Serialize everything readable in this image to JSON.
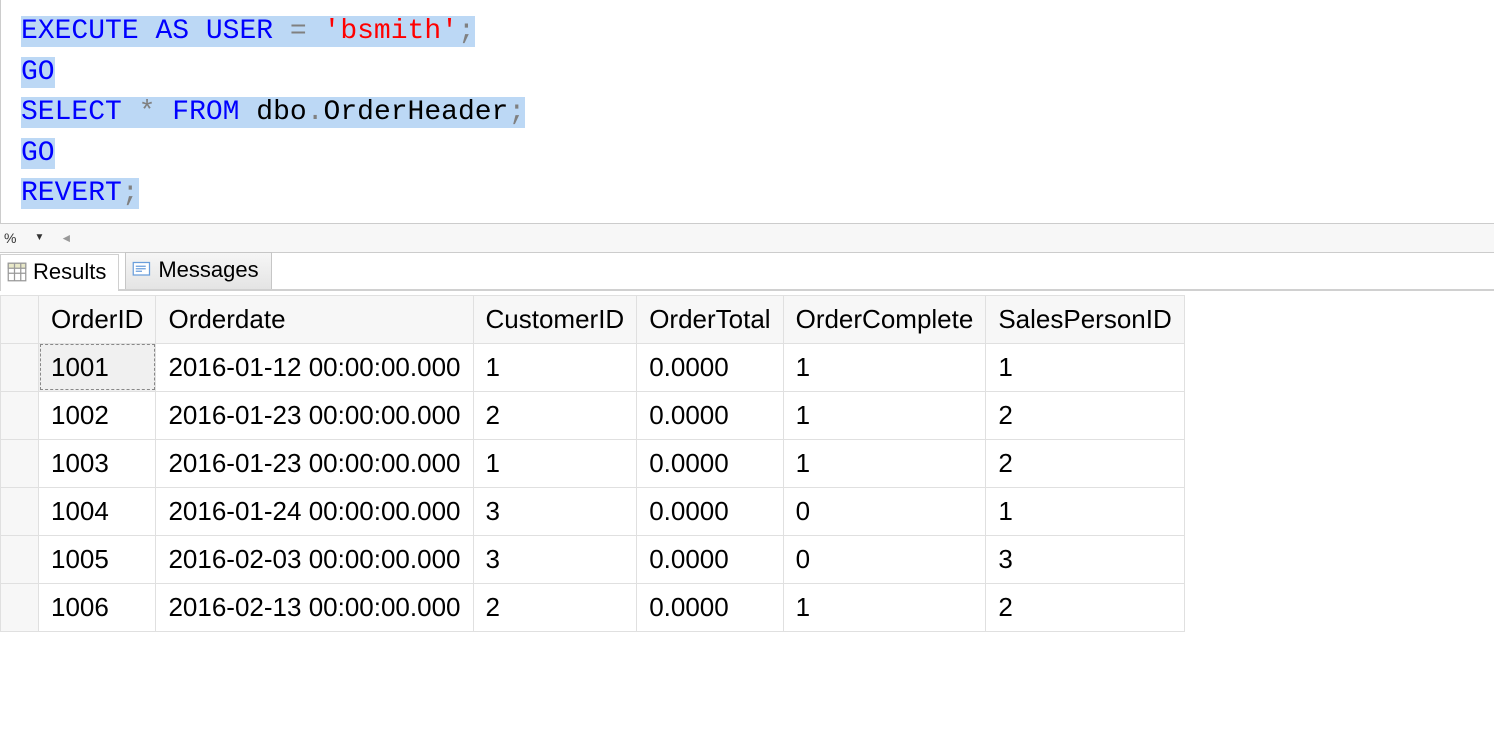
{
  "editor": {
    "lines": [
      [
        {
          "t": "EXECUTE",
          "cls": "kw hl"
        },
        {
          "t": " ",
          "cls": "hl"
        },
        {
          "t": "AS",
          "cls": "kw hl"
        },
        {
          "t": " ",
          "cls": "hl"
        },
        {
          "t": "USER",
          "cls": "kw hl"
        },
        {
          "t": " ",
          "cls": "hl"
        },
        {
          "t": "=",
          "cls": "op hl"
        },
        {
          "t": " ",
          "cls": "hl"
        },
        {
          "t": "'bsmith'",
          "cls": "str hl"
        },
        {
          "t": ";",
          "cls": "punct hl"
        }
      ],
      [
        {
          "t": "GO",
          "cls": "kw hl"
        }
      ],
      [
        {
          "t": "SELECT",
          "cls": "kw hl"
        },
        {
          "t": " ",
          "cls": "hl"
        },
        {
          "t": "*",
          "cls": "op hl"
        },
        {
          "t": " ",
          "cls": "hl"
        },
        {
          "t": "FROM",
          "cls": "kw hl"
        },
        {
          "t": " ",
          "cls": "hl"
        },
        {
          "t": "dbo",
          "cls": "obj hl"
        },
        {
          "t": ".",
          "cls": "op hl"
        },
        {
          "t": "OrderHeader",
          "cls": "obj hl"
        },
        {
          "t": ";",
          "cls": "punct hl"
        }
      ],
      [
        {
          "t": "GO",
          "cls": "kw hl"
        }
      ],
      [
        {
          "t": "REVERT",
          "cls": "kw hl"
        },
        {
          "t": ";",
          "cls": "punct hl"
        }
      ]
    ]
  },
  "toolbar": {
    "dropdown_glyph": "▼",
    "scroll_left_glyph": "◄"
  },
  "tabs": {
    "results": "Results",
    "messages": "Messages"
  },
  "results": {
    "columns": [
      "OrderID",
      "Orderdate",
      "CustomerID",
      "OrderTotal",
      "OrderComplete",
      "SalesPersonID"
    ],
    "rows": [
      [
        "1001",
        "2016-01-12 00:00:00.000",
        "1",
        "0.0000",
        "1",
        "1"
      ],
      [
        "1002",
        "2016-01-23 00:00:00.000",
        "2",
        "0.0000",
        "1",
        "2"
      ],
      [
        "1003",
        "2016-01-23 00:00:00.000",
        "1",
        "0.0000",
        "1",
        "2"
      ],
      [
        "1004",
        "2016-01-24 00:00:00.000",
        "3",
        "0.0000",
        "0",
        "1"
      ],
      [
        "1005",
        "2016-02-03 00:00:00.000",
        "3",
        "0.0000",
        "0",
        "3"
      ],
      [
        "1006",
        "2016-02-13 00:00:00.000",
        "2",
        "0.0000",
        "1",
        "2"
      ]
    ]
  }
}
